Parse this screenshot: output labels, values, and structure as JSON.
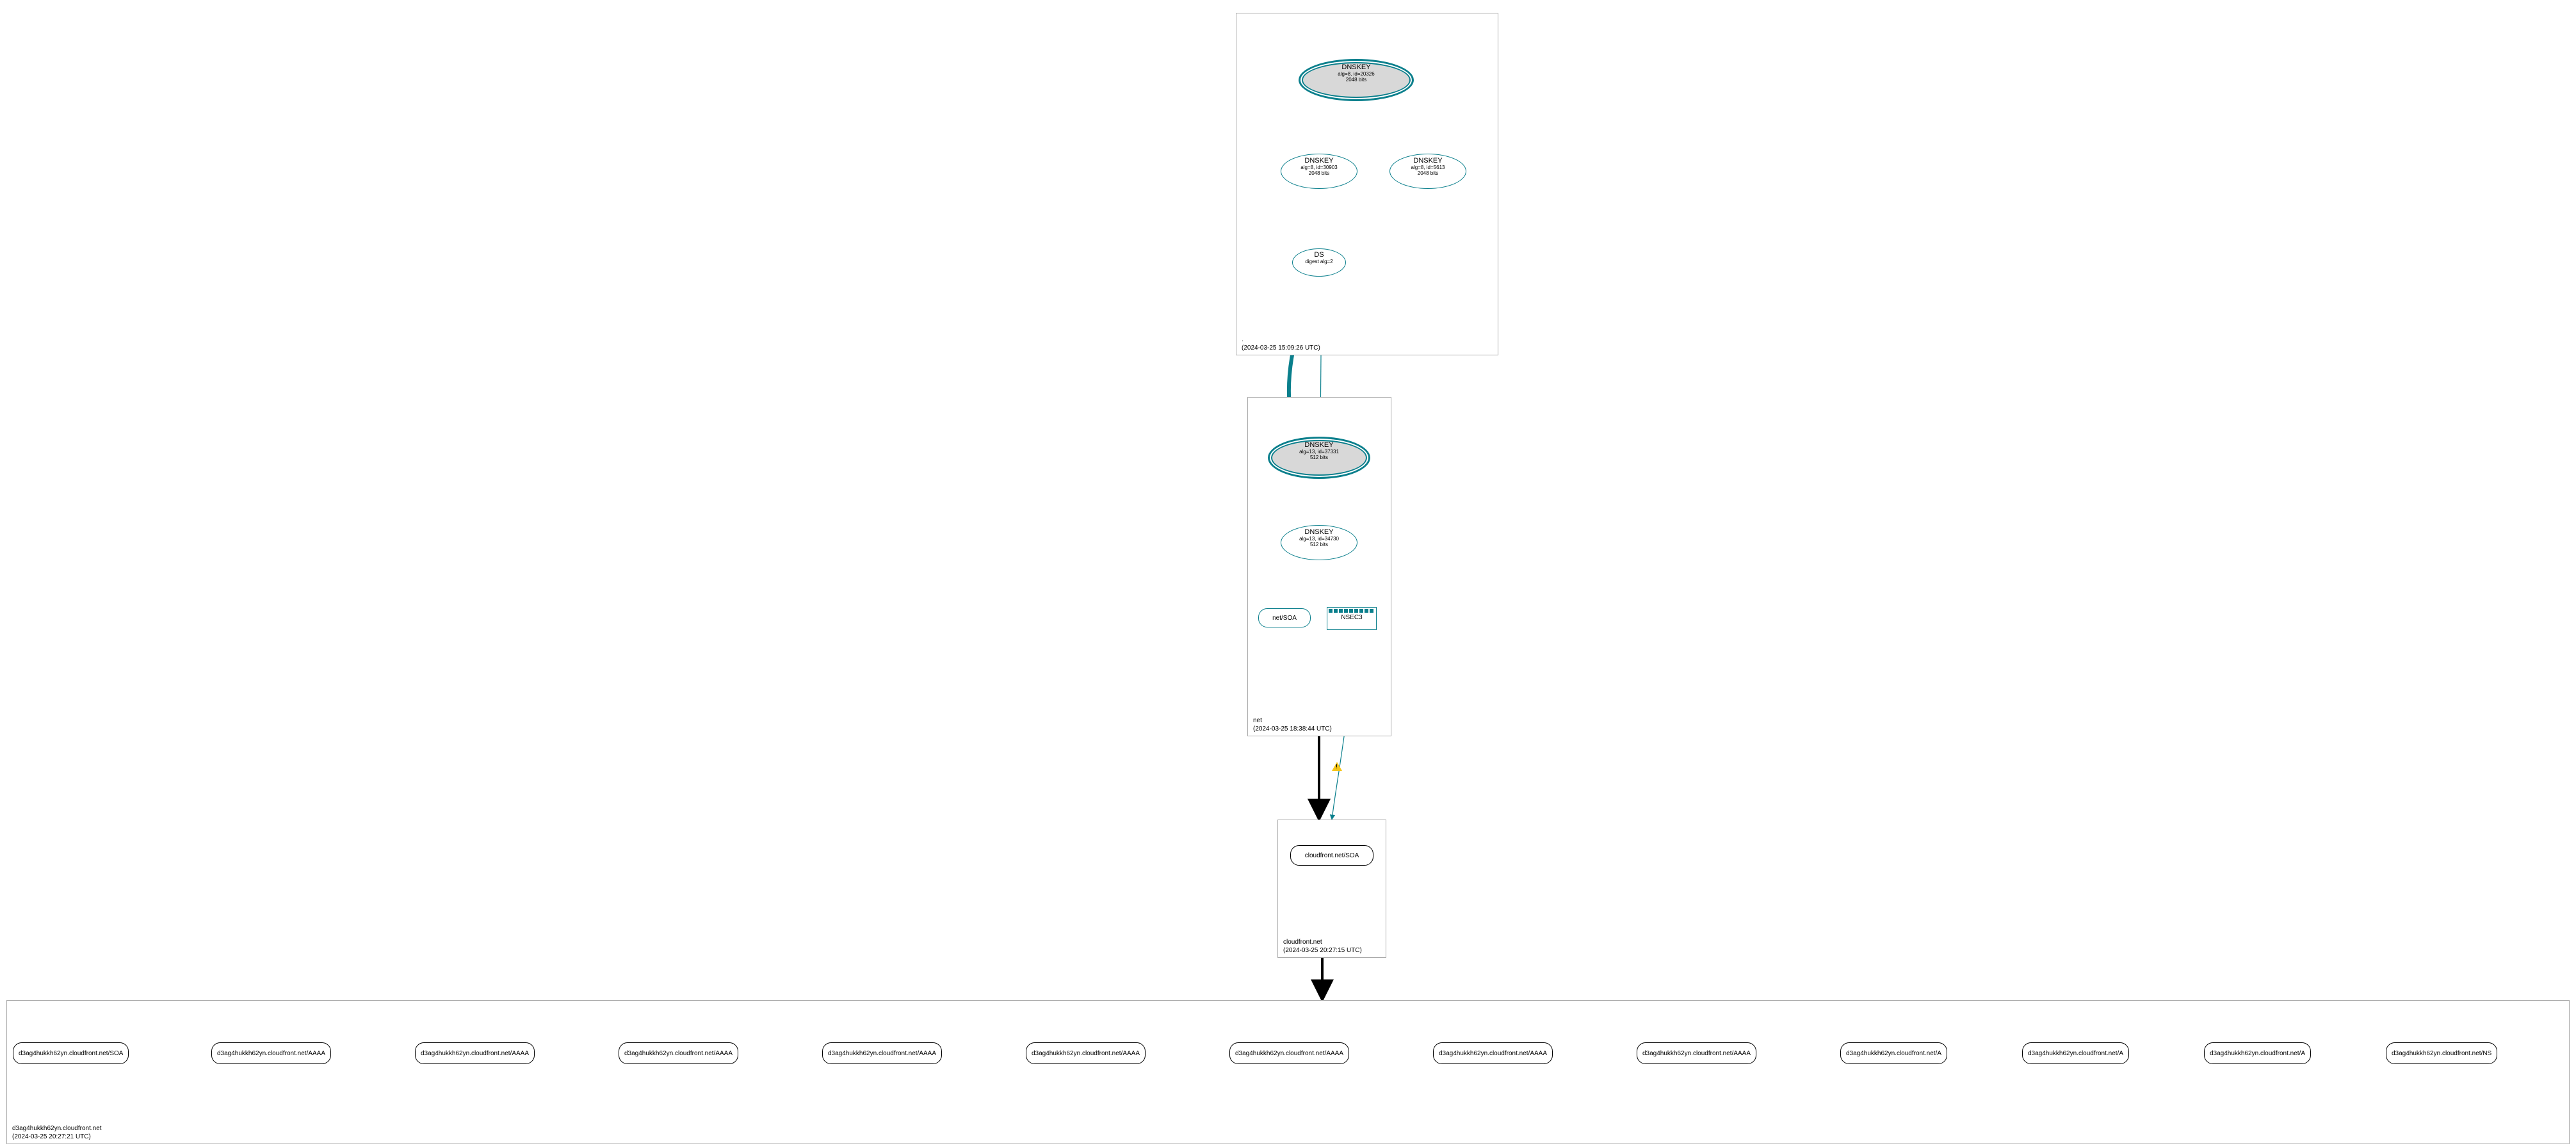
{
  "zones": {
    "root": {
      "name": ".",
      "timestamp": "(2024-03-25 15:09:26 UTC)",
      "ksk": {
        "title": "DNSKEY",
        "alg": "alg=8, id=20326",
        "bits": "2048 bits"
      },
      "zsk1": {
        "title": "DNSKEY",
        "alg": "alg=8, id=30903",
        "bits": "2048 bits"
      },
      "zsk2": {
        "title": "DNSKEY",
        "alg": "alg=8, id=5613",
        "bits": "2048 bits"
      },
      "ds": {
        "title": "DS",
        "digest": "digest alg=2"
      }
    },
    "net": {
      "name": "net",
      "timestamp": "(2024-03-25 18:38:44 UTC)",
      "ksk": {
        "title": "DNSKEY",
        "alg": "alg=13, id=37331",
        "bits": "512 bits"
      },
      "zsk": {
        "title": "DNSKEY",
        "alg": "alg=13, id=34730",
        "bits": "512 bits"
      },
      "soa": "net/SOA",
      "nsec3": "NSEC3"
    },
    "cloudfront": {
      "name": "cloudfront.net",
      "timestamp": "(2024-03-25 20:27:15 UTC)",
      "soa": "cloudfront.net/SOA"
    },
    "leaf": {
      "name": "d3ag4hukkh62yn.cloudfront.net",
      "timestamp": "(2024-03-25 20:27:21 UTC)",
      "records": [
        "d3ag4hukkh62yn.cloudfront.net/SOA",
        "d3ag4hukkh62yn.cloudfront.net/AAAA",
        "d3ag4hukkh62yn.cloudfront.net/AAAA",
        "d3ag4hukkh62yn.cloudfront.net/AAAA",
        "d3ag4hukkh62yn.cloudfront.net/AAAA",
        "d3ag4hukkh62yn.cloudfront.net/AAAA",
        "d3ag4hukkh62yn.cloudfront.net/AAAA",
        "d3ag4hukkh62yn.cloudfront.net/AAAA",
        "d3ag4hukkh62yn.cloudfront.net/AAAA",
        "d3ag4hukkh62yn.cloudfront.net/A",
        "d3ag4hukkh62yn.cloudfront.net/A",
        "d3ag4hukkh62yn.cloudfront.net/A",
        "d3ag4hukkh62yn.cloudfront.net/NS"
      ]
    }
  },
  "colors": {
    "teal": "#0a7f8c",
    "black": "#000000",
    "kskFill": "#d8d8d8"
  }
}
